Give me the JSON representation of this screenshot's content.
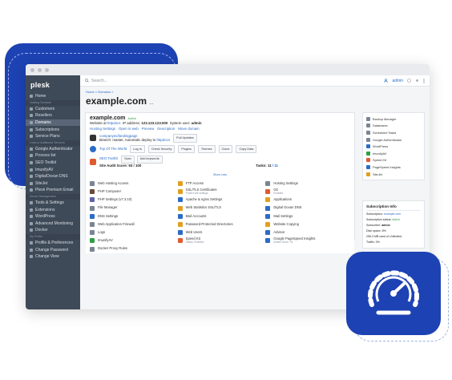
{
  "app": {
    "logo": "plesk"
  },
  "search": {
    "placeholder": "Search..."
  },
  "topbar": {
    "user": "admin"
  },
  "breadcrumb": "Home > Domains >",
  "page_title": "example.com",
  "page_title_suffix": "...",
  "sidebar": {
    "items": [
      {
        "type": "item",
        "label": "Home"
      },
      {
        "type": "section",
        "label": "Hosting Services"
      },
      {
        "type": "item",
        "label": "Customers"
      },
      {
        "type": "item",
        "label": "Resellers"
      },
      {
        "type": "item",
        "label": "Domains",
        "active": true
      },
      {
        "type": "item",
        "label": "Subscriptions"
      },
      {
        "type": "item",
        "label": "Service Plans"
      },
      {
        "type": "section",
        "label": "Links to Additional Services"
      },
      {
        "type": "item",
        "label": "Google Authenticator"
      },
      {
        "type": "item",
        "label": "Process list"
      },
      {
        "type": "item",
        "label": "SEO Toolkit"
      },
      {
        "type": "item",
        "label": "ImunifyAV"
      },
      {
        "type": "item",
        "label": "DigitalOcean DNS"
      },
      {
        "type": "item",
        "label": "SiteJet"
      },
      {
        "type": "item",
        "label": "Plesk Premium Email"
      },
      {
        "type": "section",
        "label": "Server Management"
      },
      {
        "type": "item",
        "label": "Tools & Settings"
      },
      {
        "type": "item",
        "label": "Extensions"
      },
      {
        "type": "item",
        "label": "WordPress"
      },
      {
        "type": "item",
        "label": "Advanced Monitoring"
      },
      {
        "type": "item",
        "label": "Docker"
      },
      {
        "type": "section",
        "label": "My Profile"
      },
      {
        "type": "item",
        "label": "Profile & Preferences"
      },
      {
        "type": "item",
        "label": "Change Password"
      },
      {
        "type": "item",
        "label": "Change View"
      }
    ]
  },
  "card": {
    "domain": "example.com",
    "status": "Active",
    "website_at": "Website at",
    "website_at_link": "httpdocs",
    "ip_label": "IP address:",
    "ip": "123.123.123.000",
    "sysuser_label": "System user:",
    "sysuser": "admin",
    "links": [
      "Hosting Settings",
      "Open in web",
      "Preview",
      "Description",
      "Move domain"
    ],
    "git_repo": "companyex/landingpage",
    "git_branch": "Branch: master, Automatic deploy to",
    "git_branch_link": "httpdocs",
    "pull_button": "Pull Updates",
    "wp_title": "Top Of The World",
    "wp_buttons": [
      "Log In",
      "Check Security",
      "Plugins",
      "Themes",
      "Clone",
      "Copy Data"
    ],
    "seo_title": "SEO Toolkit",
    "seo_buttons": [
      "Scan",
      "Add keywords"
    ],
    "seo_audit": "Site Audit Score: 93 / 100",
    "seo_tasks_label": "Tasks:",
    "seo_tasks": "11",
    "seo_tasks_extra": "/ 11",
    "show_less": "Show Less"
  },
  "tools": [
    {
      "label": "Web Hosting Access",
      "color": "#7a8594"
    },
    {
      "label": "FTP Access",
      "color": "#e0a020"
    },
    {
      "label": "Hosting Settings",
      "color": "#7a8594"
    },
    {
      "label": "PHP Composer",
      "color": "#6b4a3a"
    },
    {
      "label": "SSL/TLS Certificates",
      "sub": "Protect site settings",
      "color": "#e0a020"
    },
    {
      "label": "Git",
      "sub": "Enabled",
      "color": "#e05a30"
    },
    {
      "label": "PHP Settings (v7.3.10)",
      "color": "#5b64a8"
    },
    {
      "label": "Apache & nginx Settings",
      "color": "#2b6cc6"
    },
    {
      "label": "Applications",
      "color": "#e0a020"
    },
    {
      "label": "File Manager",
      "color": "#7a8594"
    },
    {
      "label": "Web Statistics SSL/TLS",
      "color": "#e0a020"
    },
    {
      "label": "Digital Ocean DNS",
      "color": "#2b6cc6"
    },
    {
      "label": "DNS Settings",
      "color": "#2b6cc6"
    },
    {
      "label": "Mail Accounts",
      "color": "#2b6cc6"
    },
    {
      "label": "Mail Settings",
      "color": "#2b6cc6"
    },
    {
      "label": "Web Application Firewall",
      "color": "#7a8594"
    },
    {
      "label": "Password-Protected Directories",
      "color": "#e0a020"
    },
    {
      "label": "Website Copying",
      "color": "#e0a020"
    },
    {
      "label": "Logs",
      "color": "#7a8594"
    },
    {
      "label": "Web Users",
      "color": "#2b6cc6"
    },
    {
      "label": "Advisor",
      "color": "#2b6cc6"
    },
    {
      "label": "ImunifyAV",
      "color": "#2f9e44"
    },
    {
      "label": "Speed Kit",
      "sub": "Status: Enabled",
      "color": "#e05a30"
    },
    {
      "label": "Google PageSpeed Insights",
      "sub": "Mobile Score: 94",
      "color": "#2b6cc6"
    },
    {
      "label": "Docker Proxy Rules",
      "color": "#7a8594"
    }
  ],
  "right_panel": [
    {
      "label": "Backup Manager",
      "color": "#7a8594"
    },
    {
      "label": "Databases",
      "color": "#7a8594"
    },
    {
      "label": "Scheduled Tasks",
      "color": "#7a8594"
    },
    {
      "label": "Google Authenticator",
      "color": "#7a8594"
    },
    {
      "label": "WordPress",
      "color": "#2b6cc6"
    },
    {
      "label": "ImunifyAV",
      "color": "#2f9e44"
    },
    {
      "label": "Speed Kit",
      "color": "#e05a30"
    },
    {
      "label": "PageSpeed Insights",
      "color": "#2b6cc6"
    },
    {
      "label": "SiteJet",
      "color": "#e0a020"
    }
  ],
  "subscription": {
    "title": "Subscription Info",
    "line1_label": "Subscription:",
    "line1": "example.com",
    "line2_label": "Subscription status:",
    "line2": "Active",
    "line3_label": "Subscriber:",
    "line3": "admin",
    "line4": "Disk space: 8%",
    "line5": "256.3 MB used of Unlimited",
    "line6": "Traffic: 0%"
  },
  "colors": {
    "brand": "#1d42b3",
    "sidebar": "#3f4a58",
    "link": "#2b6cc6"
  }
}
